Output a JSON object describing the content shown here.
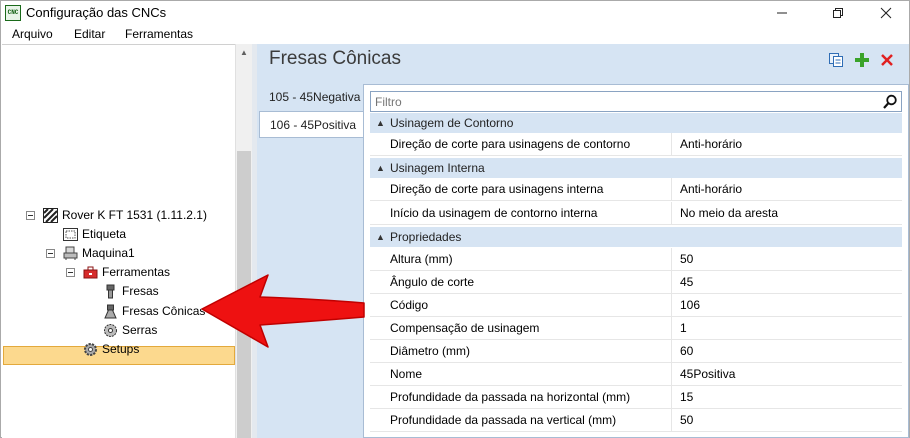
{
  "window": {
    "title": "Configuração das CNCs",
    "app_icon_text": "CNC"
  },
  "menu": {
    "items": [
      "Arquivo",
      "Editar",
      "Ferramentas"
    ]
  },
  "tree": {
    "items": [
      {
        "label": "Rover K FT 1531 (1.11.2.1)",
        "icon": "machine-striped-icon"
      },
      {
        "label": "Etiqueta",
        "icon": "label-icon"
      },
      {
        "label": "Maquina1",
        "icon": "machine-icon"
      },
      {
        "label": "Ferramentas",
        "icon": "toolbox-icon"
      },
      {
        "label": "Fresas",
        "icon": "mill-icon"
      },
      {
        "label": "Fresas Cônicas",
        "icon": "conical-mill-icon"
      },
      {
        "label": "Serras",
        "icon": "saw-icon"
      },
      {
        "label": "Setups",
        "icon": "gear-icon"
      }
    ],
    "selected": "Fresas Cônicas"
  },
  "panel": {
    "title": "Fresas Cônicas",
    "tabs": [
      "105 - 45Negativa",
      "106 - 45Positiva"
    ],
    "active_tab": "106 - 45Positiva",
    "filter_placeholder": "Filtro",
    "groups": [
      {
        "title": "Usinagem de Contorno",
        "rows": [
          {
            "name": "Direção de corte para usinagens de contorno",
            "value": "Anti-horário"
          }
        ]
      },
      {
        "title": "Usinagem Interna",
        "rows": [
          {
            "name": "Direção de corte para usinagens interna",
            "value": "Anti-horário"
          },
          {
            "name": "Início da usinagem de contorno interna",
            "value": "No meio da aresta"
          }
        ]
      },
      {
        "title": "Propriedades",
        "rows": [
          {
            "name": "Altura (mm)",
            "value": "50"
          },
          {
            "name": "Ângulo de corte",
            "value": "45"
          },
          {
            "name": "Código",
            "value": "106"
          },
          {
            "name": "Compensação de usinagem",
            "value": "1"
          },
          {
            "name": "Diâmetro (mm)",
            "value": "60"
          },
          {
            "name": "Nome",
            "value": "45Positiva"
          },
          {
            "name": "Profundidade da passada na horizontal (mm)",
            "value": "15"
          },
          {
            "name": "Profundidade da passada na vertical (mm)",
            "value": "50"
          }
        ]
      }
    ]
  },
  "colors": {
    "selection": "#fcd98e",
    "panel_bg": "#d6e4f3",
    "annotation_arrow": "#ee1111",
    "add_icon": "#3aa32a",
    "delete_icon": "#e02020"
  }
}
